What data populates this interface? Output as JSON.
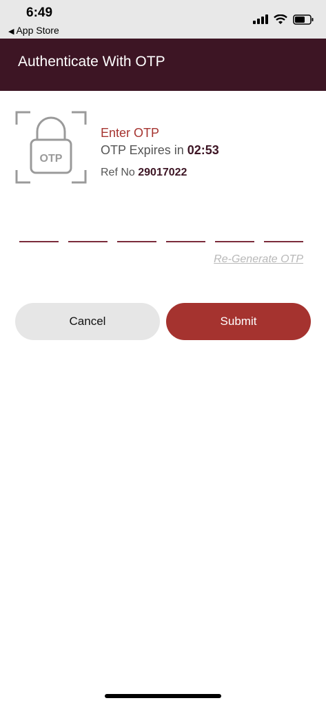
{
  "status_bar": {
    "time": "6:49",
    "back_app": "App Store",
    "back_icon": "back-triangle-icon",
    "icons": [
      "signal-icon",
      "wifi-icon",
      "battery-icon"
    ]
  },
  "header": {
    "title": "Authenticate With OTP"
  },
  "otp_info": {
    "graphic_text": "OTP",
    "enter_label": "Enter OTP",
    "expires_label": "OTP Expires in",
    "expires_time": "02:53",
    "ref_label": "Ref No",
    "ref_number": "29017022"
  },
  "otp_input": {
    "digits": [
      "",
      "",
      "",
      "",
      "",
      ""
    ],
    "regenerate_label": "Re-Generate OTP"
  },
  "actions": {
    "cancel_label": "Cancel",
    "submit_label": "Submit"
  },
  "colors": {
    "header_bg": "#3d1524",
    "accent": "#a5332f",
    "cancel_bg": "#e6e6e6"
  }
}
